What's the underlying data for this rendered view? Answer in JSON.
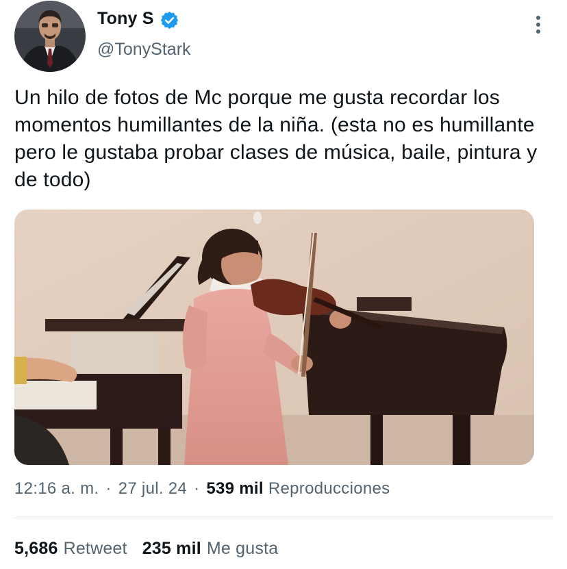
{
  "author": {
    "display_name": "Tony S",
    "handle": "@TonyStark",
    "verified_icon": "verified-badge-icon",
    "more_icon": "more-vertical-icon"
  },
  "tweet": {
    "text": "Un hilo de fotos de Mc porque me gusta recordar los momentos humillantes de la niña. (esta no es humillante pero le gustaba probar clases de música, baile, pintura y de todo)"
  },
  "meta": {
    "time": "12:16 a. m.",
    "separator": "·",
    "date": "27 jul. 24",
    "views_count": "539 mil",
    "views_label": "Reproducciones"
  },
  "stats": {
    "retweets_count": "5,686",
    "retweets_label": "Retweet",
    "likes_count": "235 mil",
    "likes_label": "Me gusta"
  },
  "colors": {
    "accent": "#1d9bf0",
    "secondary_text": "#536471",
    "primary_text": "#0f1419",
    "divider": "#e1e4e8"
  }
}
